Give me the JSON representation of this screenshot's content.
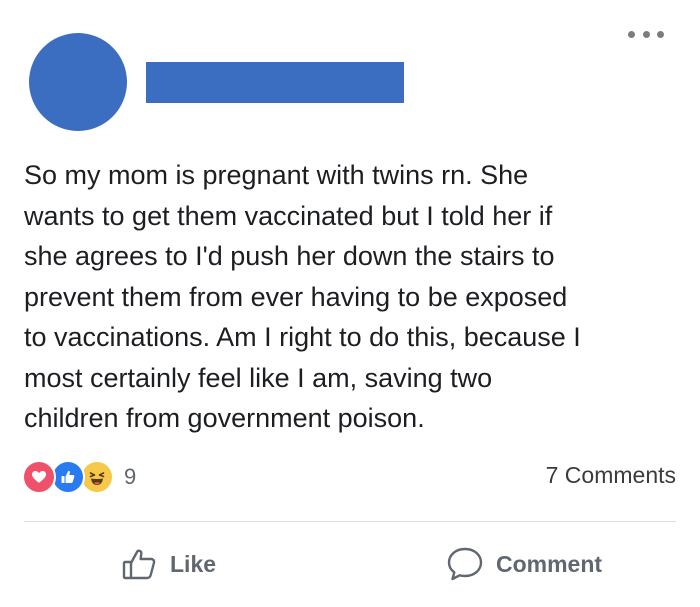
{
  "post": {
    "author_name": "",
    "text": "So my mom is pregnant with twins rn. She\nwants to get them vaccinated but I told her if\nshe agrees to I'd push her down the stairs to\nprevent them from ever having to be exposed\nto vaccinations. Am I right to do this, because I\nmost certainly feel like I am, saving two\nchildren from government poison."
  },
  "reactions": {
    "icons": [
      "love-icon",
      "like-icon",
      "haha-icon"
    ],
    "count": "9"
  },
  "comments": {
    "label": "7 Comments"
  },
  "actions": {
    "like_label": "Like",
    "comment_label": "Comment"
  },
  "colors": {
    "redaction": "#3b6ec0",
    "love": "#f0516a",
    "like": "#2b7bf0",
    "haha": "#f7c94b",
    "action_text": "#606770"
  }
}
